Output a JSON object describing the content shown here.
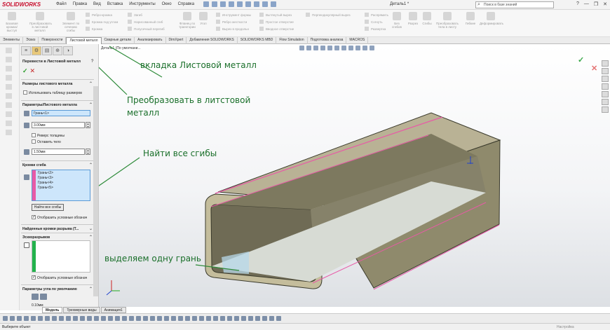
{
  "app": {
    "logo": "SOLIDWORKS",
    "menu": [
      "Файл",
      "Правка",
      "Вид",
      "Вставка",
      "Инструменты",
      "Окно",
      "Справка"
    ],
    "document_title": "Деталь1 *",
    "search_placeholder": "Поиск в базе знаний",
    "window_buttons": [
      "?",
      "—",
      "❐",
      "✕"
    ]
  },
  "ribbon": {
    "big_buttons": [
      "Базовая кромка/выступ",
      "Преобразовать в листовой металл",
      "Элемент по сечению сгибы"
    ],
    "col1": [
      "Ребро-кромка",
      "Кромка под углом",
      "Кромка"
    ],
    "col2": [
      "Загиб",
      "Нарисованный сгиб",
      "Полусечный перегиб"
    ],
    "btn_flange": "Фланец по траектории",
    "btn_corner": "Угол",
    "col3": [
      "Инструмент формы",
      "Ребро жесткости",
      "Вырез в продольн"
    ],
    "col4": [
      "Вытянутый вырез",
      "Простое отверстие",
      "Вводное отверстие"
    ],
    "col5": [
      "Перпендикулярный вырез"
    ],
    "col6": [
      "Распрямить",
      "Согнуть",
      "Развертка"
    ],
    "btn_nobend": "Без сгибов",
    "btn_rip": "Разрез",
    "btn_bends": "Сгибы",
    "btn_convert_body": "Преобразовать тела в листу",
    "btn_flex": "Гибкие",
    "btn_deform": "Деформировать"
  },
  "tabs": [
    "Элементы",
    "Эскиз",
    "Поверхности",
    "Листовой металл",
    "Сварные детали",
    "Анализировать",
    "DimXpert",
    "Добавления SOLIDWORKS",
    "SOLIDWORKS MBD",
    "Flow Simulation",
    "Подготовка анализа",
    "MACROS"
  ],
  "active_tab": "Листовой металл",
  "property_manager": {
    "title": "Перевести в Листовой металл",
    "help": "?",
    "sheet_params_group": "Размеры листового металла",
    "use_gauge_table": "Использовать таблицу размеров",
    "params_group": "Параметры/Листового металла",
    "fixed_face": "Грань<1>",
    "thickness": "3.00мм",
    "reverse_thickness": "Реверс толщины",
    "keep_body": "Оставить тело",
    "bend_radius": "1.50мм",
    "bend_edges_group": "Кромки сгиба",
    "bend_edges": [
      "Грань<2>",
      "Грань<3>",
      "Грань<4>",
      "Грань<5>"
    ],
    "find_bends_button": "Найти все сгибы",
    "show_callouts_1": "Отобразить условные обознач",
    "rip_edges_group": "Найденные кромки разрыва (Т...",
    "rip_sketch_group": "Эскизразрывов",
    "show_callouts_2": "Отобразить условные обознач",
    "default_corner_group": "Параметры угла по умолчанию",
    "corner_gap": "0.10мм"
  },
  "viewport": {
    "tree_label": "Деталь1  (По умолчани..."
  },
  "annotations": {
    "tab_hint": "вкладка Листовой металл",
    "convert_hint_1": "Преобразовать в литстовой",
    "convert_hint_2": "металл",
    "find_bends_hint": "Найти все сгибы",
    "select_face_hint": "выделяем одну грань"
  },
  "bottom_tabs": [
    "Модель",
    "Трехмерные виды",
    "Анимация1"
  ],
  "status": {
    "left": "Выберите объект",
    "right": "Настройка"
  },
  "colors": {
    "annotation_green": "#1a6f2a",
    "pink_selection": "#e85aa6",
    "green_selection": "#22b24c",
    "accent_red": "#c8102e"
  }
}
